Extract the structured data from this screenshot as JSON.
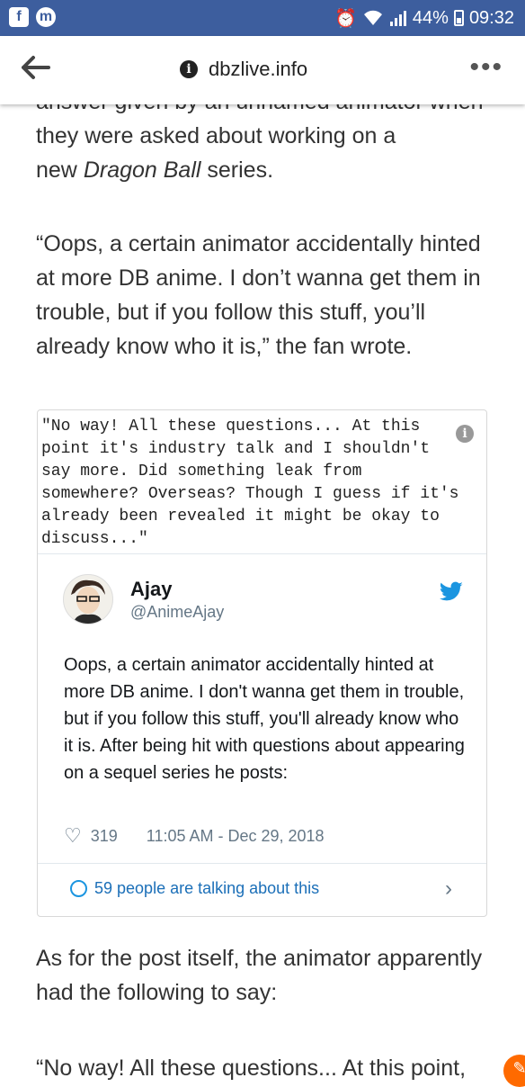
{
  "status_bar": {
    "battery": "44%",
    "time": "09:32",
    "app_icon_1": "f",
    "app_icon_2": "m"
  },
  "address_bar": {
    "url": "dbzlive.info"
  },
  "article": {
    "cut_line": "answer given by an unnamed animator when",
    "p1_line1": "they were asked about working on a",
    "p1_line2_pre": "new ",
    "p1_line2_em": "Dragon Ball",
    "p1_line2_post": " series.",
    "p2": "“Oops, a certain animator accidentally hinted at more DB anime. I don’t wanna get them in trouble, but if you follow this stuff, you’ll already know who it is,” the fan wrote.",
    "p3": "As for the post itself, the animator apparently had the following to say:",
    "p4": "“No way! All these questions... At this point,"
  },
  "tweet": {
    "image_quote": "\"No way! All these questions... At this\npoint it's industry talk and I shouldn't\nsay more. Did something leak from\nsomewhere? Overseas? Though I guess if it's\nalready been revealed it might be okay to\ndiscuss...\"",
    "author_name": "Ajay",
    "author_handle": "@AnimeAjay",
    "text": "Oops, a certain animator accidentally hinted at more DB anime. I don't wanna get them in trouble, but if you follow this stuff, you'll already know who it is. After being hit with questions about appearing on a sequel series he posts:",
    "likes": "319",
    "timestamp": "11:05 AM - Dec 29, 2018",
    "talking": "59 people are talking about this"
  },
  "colors": {
    "status_bar": "#3d5e9e",
    "twitter_blue": "#1b95e0",
    "link_blue": "#1b6fb8"
  }
}
